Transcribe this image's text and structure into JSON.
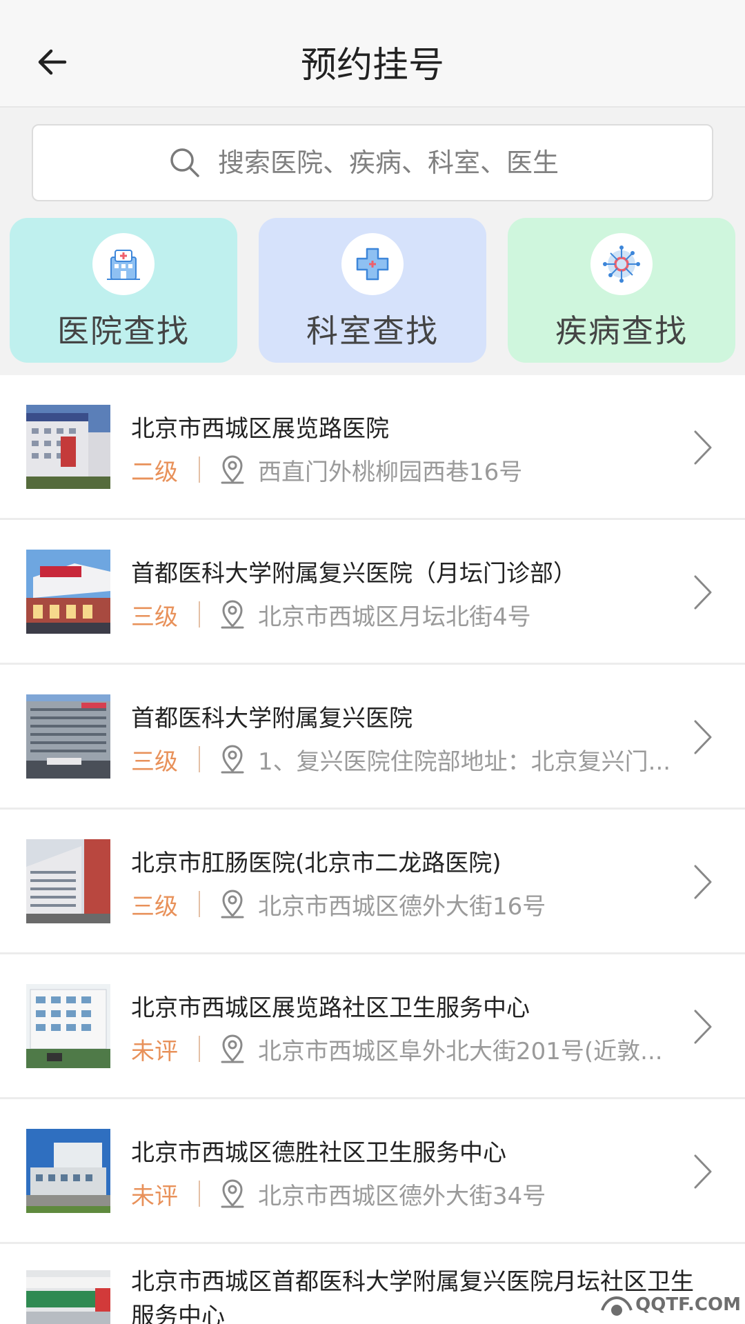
{
  "header": {
    "title": "预约挂号",
    "back_icon": "arrow-left-icon"
  },
  "search": {
    "placeholder": "搜索医院、疾病、科室、医生",
    "icon": "search-icon"
  },
  "quick_links": [
    {
      "label": "医院查找",
      "icon": "hospital-icon",
      "bg": "#bff0ee"
    },
    {
      "label": "科室查找",
      "icon": "medical-cross-icon",
      "bg": "#d6e2fb"
    },
    {
      "label": "疾病查找",
      "icon": "virus-icon",
      "bg": "#cff6dd"
    }
  ],
  "colors": {
    "level": "#e8915a",
    "address": "#9a9a9a"
  },
  "hospitals": [
    {
      "name": "北京市西城区展览路医院",
      "level": "二级",
      "address": "西直门外桃柳园西巷16号"
    },
    {
      "name": "首都医科大学附属复兴医院（月坛门诊部）",
      "level": "三级",
      "address": "北京市西城区月坛北街4号"
    },
    {
      "name": "首都医科大学附属复兴医院",
      "level": "三级",
      "address": "1、复兴医院住院部地址：北京复兴门..."
    },
    {
      "name": "北京市肛肠医院(北京市二龙路医院)",
      "level": "三级",
      "address": "北京市西城区德外大街16号"
    },
    {
      "name": "北京市西城区展览路社区卫生服务中心",
      "level": "未评",
      "address": "北京市西城区阜外北大街201号(近敦..."
    },
    {
      "name": "北京市西城区德胜社区卫生服务中心",
      "level": "未评",
      "address": "北京市西城区德外大街34号"
    },
    {
      "name": "北京市西城区首都医科大学附属复兴医院月坛社区卫生服务中心"
    }
  ],
  "watermark": {
    "text": "QQTF.COM"
  }
}
